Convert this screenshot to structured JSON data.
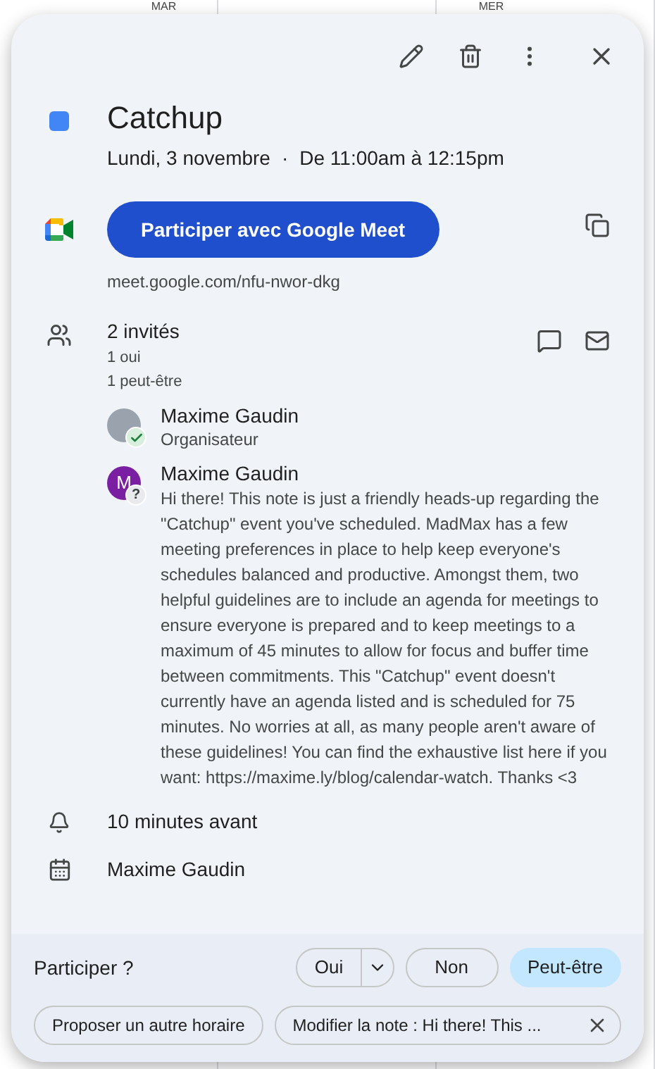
{
  "background_calendar": {
    "day_labels": [
      "MAR",
      "MER"
    ]
  },
  "event": {
    "title": "Catchup",
    "color": "#4285f4",
    "date": "Lundi, 3 novembre",
    "separator": "·",
    "time": "De 11:00am à 12:15pm"
  },
  "meet": {
    "button": "Participer avec Google Meet",
    "link": "meet.google.com/nfu-nwor-dkg"
  },
  "guests": {
    "count": "2 invités",
    "summary": [
      "1 oui",
      "1 peut-être"
    ],
    "list": [
      {
        "name": "Maxime Gaudin",
        "kind": "photo",
        "accepted": true,
        "role": "Organisateur"
      },
      {
        "name": "Maxime Gaudin",
        "kind": "initial",
        "initial": "M",
        "accepted": false,
        "badge": "?",
        "note": "Hi there! This note is just a friendly heads-up regarding the \"Catchup\" event you've scheduled. MadMax has a few meeting preferences in place to help keep everyone's schedules balanced and productive. Amongst them, two helpful guidelines are to include an agenda for meetings to ensure everyone is prepared and to keep meetings to a maximum of 45 minutes to allow for focus and buffer time between commitments. This \"Catchup\" event doesn't currently have an agenda listed and is scheduled for 75 minutes. No worries at all, as many people aren't aware of these guidelines! You can find the exhaustive list here if you want: https://maxime.ly/blog/calendar-watch. Thanks <3"
      }
    ]
  },
  "reminder": "10 minutes avant",
  "calendar": "Maxime Gaudin",
  "rsvp": {
    "label": "Participer ?",
    "options": [
      {
        "label": "Oui",
        "selected": false,
        "dropdown": true
      },
      {
        "label": "Non",
        "selected": false,
        "dropdown": false
      },
      {
        "label": "Peut-être",
        "selected": true,
        "dropdown": false
      }
    ]
  },
  "actions": {
    "propose": "Proposer un autre horaire",
    "note": "Modifier la note : Hi there! This ..."
  }
}
